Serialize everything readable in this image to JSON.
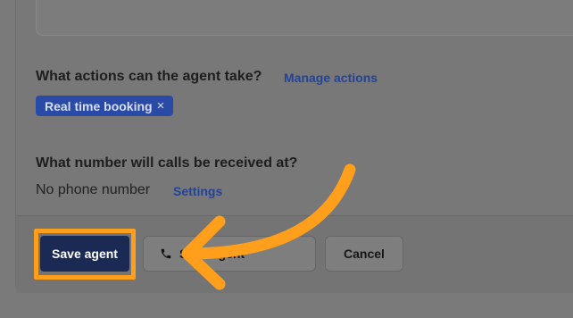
{
  "actions": {
    "question": "What actions can the agent take?",
    "manage_link": "Manage actions",
    "chips": [
      {
        "label": "Real time booking",
        "remove_glyph": "×"
      }
    ]
  },
  "number": {
    "question": "What number will calls be received at?",
    "value": "No phone number",
    "settings_link": "Settings"
  },
  "footer": {
    "save_label": "Save agent",
    "call_label": "S… t agent",
    "cancel_label": "Cancel"
  },
  "icons": {
    "phone": "phone-icon",
    "annotation": "curved-arrow-annotation"
  },
  "colors": {
    "highlight": "#ff9f1c",
    "primary_button": "#1b2a55",
    "link": "#23439a",
    "chip": "#2a4aa8"
  }
}
